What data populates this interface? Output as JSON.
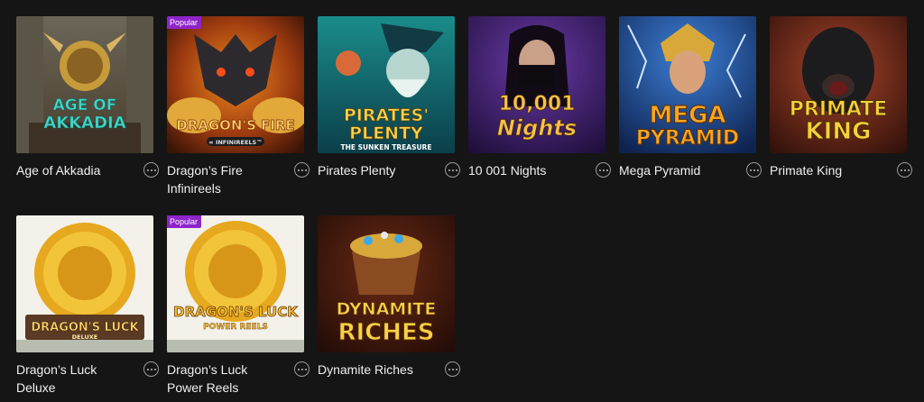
{
  "games": [
    {
      "title": "Age of Akkadia",
      "badge": "",
      "logo_lines": [
        "AGE OF",
        "AKKADIA"
      ],
      "logo_sub": ""
    },
    {
      "title": "Dragon’s Fire Infinireels",
      "badge": "Popular",
      "logo_lines": [
        "DRAGON'S FIRE"
      ],
      "logo_sub": "∞ INFINIREELS™"
    },
    {
      "title": "Pirates Plenty",
      "badge": "",
      "logo_lines": [
        "PIRATES'",
        "PLENTY"
      ],
      "logo_sub": "THE SUNKEN TREASURE"
    },
    {
      "title": "10 001 Nights",
      "badge": "",
      "logo_lines": [
        "10,001",
        "Nights"
      ],
      "logo_sub": ""
    },
    {
      "title": "Mega Pyramid",
      "badge": "",
      "logo_lines": [
        "MEGA",
        "PYRAMID"
      ],
      "logo_sub": ""
    },
    {
      "title": "Primate King",
      "badge": "",
      "logo_lines": [
        "PRIMATE",
        "KING"
      ],
      "logo_sub": ""
    },
    {
      "title": "Dragon’s Luck Deluxe",
      "badge": "",
      "logo_lines": [
        "DRAGON'S LUCK"
      ],
      "logo_sub": "DELUXE"
    },
    {
      "title": "Dragon’s Luck Power Reels",
      "badge": "Popular",
      "logo_lines": [
        "DRAGON'S LUCK"
      ],
      "logo_sub": "POWER REELS"
    },
    {
      "title": "Dynamite Riches",
      "badge": "",
      "logo_lines": [
        "DYNAMITE",
        "RICHES"
      ],
      "logo_sub": ""
    }
  ],
  "colors": {
    "badge": "#8e24c9",
    "background": "#151515"
  },
  "icons": {
    "more": "more-options-icon"
  }
}
